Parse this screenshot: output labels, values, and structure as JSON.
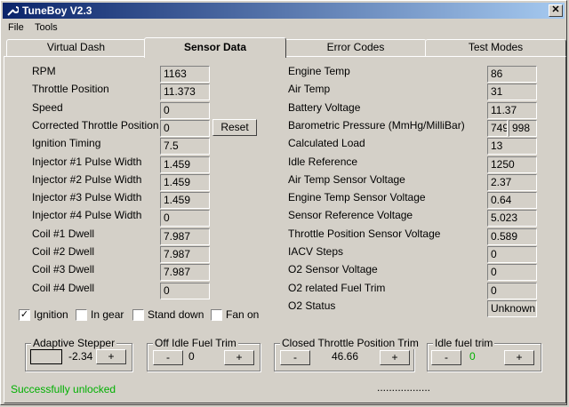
{
  "window": {
    "title": "TuneBoy V2.3",
    "close_glyph": "✕"
  },
  "menu": [
    "File",
    "Tools"
  ],
  "tabs": [
    "Virtual Dash",
    "Sensor Data",
    "Error Codes",
    "Test Modes"
  ],
  "left": [
    {
      "label": "RPM",
      "value": "1163"
    },
    {
      "label": "Throttle Position",
      "value": "11.373"
    },
    {
      "label": "Speed",
      "value": "0"
    },
    {
      "label": "Corrected Throttle Position",
      "value": "0"
    },
    {
      "label": "Ignition Timing",
      "value": "7.5"
    },
    {
      "label": "Injector #1 Pulse Width",
      "value": "1.459"
    },
    {
      "label": "Injector #2 Pulse Width",
      "value": "1.459"
    },
    {
      "label": "Injector #3 Pulse Width",
      "value": "1.459"
    },
    {
      "label": "Injector #4 Pulse Width",
      "value": "0"
    },
    {
      "label": "Coil #1 Dwell",
      "value": "7.987"
    },
    {
      "label": "Coil #2 Dwell",
      "value": "7.987"
    },
    {
      "label": "Coil #3 Dwell",
      "value": "7.987"
    },
    {
      "label": "Coil #4 Dwell",
      "value": "0"
    }
  ],
  "reset_label": "Reset",
  "right": [
    {
      "label": "Engine Temp",
      "value": "86"
    },
    {
      "label": "Air Temp",
      "value": "31"
    },
    {
      "label": "Battery Voltage",
      "value": "11.37"
    },
    {
      "label": "Barometric Pressure (MmHg/MilliBar)",
      "value": "749",
      "value2": "998"
    },
    {
      "label": "Calculated Load",
      "value": "13"
    },
    {
      "label": "Idle Reference",
      "value": "1250"
    },
    {
      "label": "Air Temp Sensor Voltage",
      "value": "2.37"
    },
    {
      "label": "Engine Temp Sensor Voltage",
      "value": "0.64"
    },
    {
      "label": "Sensor Reference Voltage",
      "value": "5.023"
    },
    {
      "label": "Throttle Position Sensor Voltage",
      "value": "0.589"
    },
    {
      "label": "IACV Steps",
      "value": "0"
    },
    {
      "label": "O2 Sensor Voltage",
      "value": "0"
    },
    {
      "label": "O2 related Fuel Trim",
      "value": "0"
    },
    {
      "label": "O2 Status",
      "value": "Unknown"
    }
  ],
  "checkboxes": [
    {
      "label": "Ignition",
      "checked": true
    },
    {
      "label": "In gear",
      "checked": false
    },
    {
      "label": "Stand down",
      "checked": false
    },
    {
      "label": "Fan on",
      "checked": false
    }
  ],
  "groups": {
    "adaptive": {
      "title": "Adaptive Stepper",
      "value": "-2.34",
      "minus": "",
      "plus": "+"
    },
    "offidle": {
      "title": "Off Idle Fuel Trim",
      "value": "0",
      "minus": "-",
      "plus": "+"
    },
    "closed": {
      "title": "Closed Throttle Position Trim",
      "value": "46.66",
      "minus": "-",
      "plus": "+"
    },
    "idlefuel": {
      "title": "Idle fuel trim",
      "value": "0",
      "minus": "-",
      "plus": "+"
    }
  },
  "status": "Successfully unlocked",
  "progress_dots": "..................",
  "colors": {
    "title_start": "#0a246a",
    "title_end": "#a6caf0",
    "status_green": "#00b000"
  }
}
